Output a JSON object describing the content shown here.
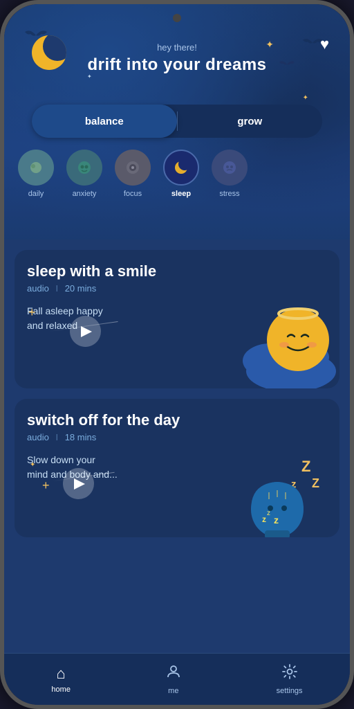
{
  "app": {
    "greeting": "hey there!",
    "title": "drift into your dreams",
    "heart_icon": "♥"
  },
  "toggle": {
    "option1": "balance",
    "option2": "grow",
    "active": "balance"
  },
  "categories": [
    {
      "id": "daily",
      "label": "daily",
      "icon": "🌅",
      "active": false,
      "color": "daily"
    },
    {
      "id": "anxiety",
      "label": "anxiety",
      "icon": "😌",
      "active": false,
      "color": "anxiety"
    },
    {
      "id": "focus",
      "label": "focus",
      "icon": "🎯",
      "active": false,
      "color": "focus"
    },
    {
      "id": "sleep",
      "label": "sleep",
      "icon": "🌙",
      "active": true,
      "color": "sleep"
    },
    {
      "id": "stress",
      "label": "stress",
      "icon": "💆",
      "active": false,
      "color": "stress"
    }
  ],
  "cards": [
    {
      "id": "card1",
      "title": "sleep with a smile",
      "type": "audio",
      "duration": "20 mins",
      "description": "Fall asleep happy\nand relaxed"
    },
    {
      "id": "card2",
      "title": "switch off for the day",
      "type": "audio",
      "duration": "18 mins",
      "description": "Slow down your\nmind and body and..."
    }
  ],
  "nav": [
    {
      "id": "home",
      "label": "home",
      "icon": "⌂",
      "active": true
    },
    {
      "id": "me",
      "label": "me",
      "icon": "👤",
      "active": false
    },
    {
      "id": "settings",
      "label": "settings",
      "icon": "⚙",
      "active": false
    }
  ],
  "meta": {
    "audio_label": "audio",
    "separator": "I",
    "plus_symbol": "+",
    "zzz": "ZZZ"
  }
}
